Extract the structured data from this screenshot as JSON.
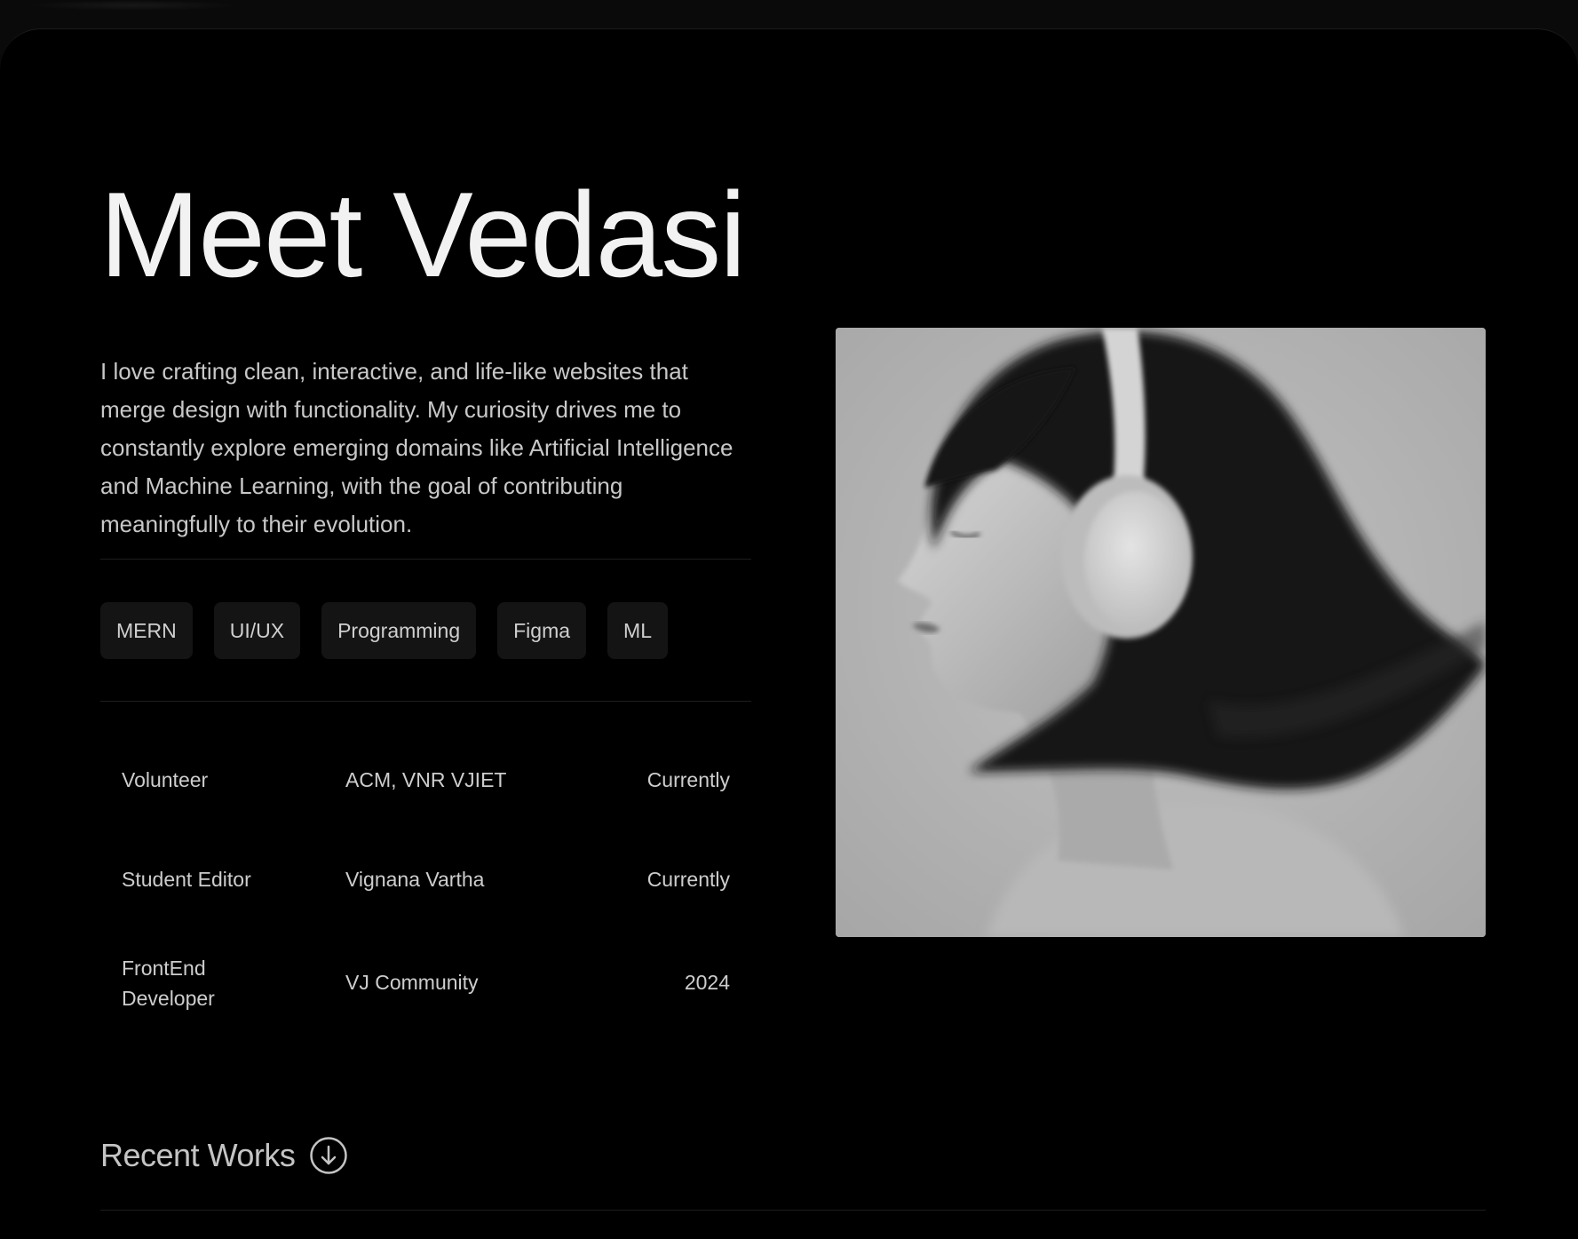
{
  "hero": {
    "title": "Meet Vedasi",
    "bio": "I love crafting clean, interactive, and life-like websites that merge design with functionality. My curiosity drives me to constantly explore emerging domains like Artificial Intelligence and Machine Learning, with the goal of contributing meaningfully to their evolution."
  },
  "skills": [
    {
      "label": "MERN"
    },
    {
      "label": "UI/UX"
    },
    {
      "label": "Programming"
    },
    {
      "label": "Figma"
    },
    {
      "label": "ML"
    }
  ],
  "experience": [
    {
      "role": "Volunteer",
      "org": "ACM, VNR VJIET",
      "when": "Currently"
    },
    {
      "role": "Student Editor",
      "org": "Vignana Vartha",
      "when": "Currently"
    },
    {
      "role": "FrontEnd Developer",
      "org": "VJ Community",
      "when": "2024"
    }
  ],
  "recent": {
    "label": "Recent Works",
    "icon": "arrow-down-circle-icon"
  },
  "portrait": {
    "icon": "portrait-image"
  },
  "colors": {
    "background": "#000000",
    "text": "#f2f2f2",
    "muted": "#c8c8c8",
    "chip": "#141414"
  }
}
